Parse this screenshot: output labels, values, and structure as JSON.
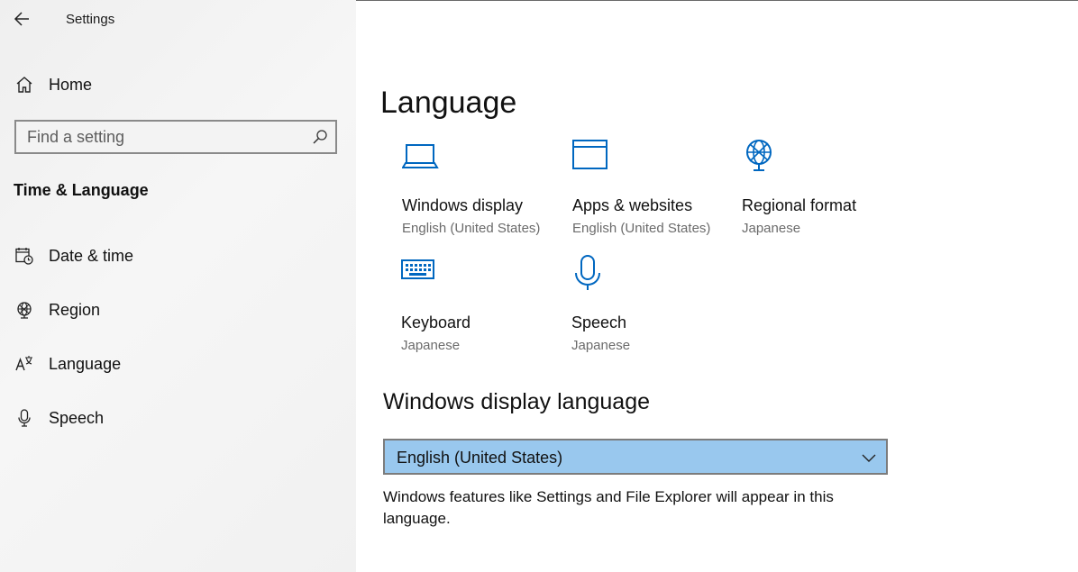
{
  "window": {
    "title": "Settings"
  },
  "sidebar": {
    "home_label": "Home",
    "search": {
      "placeholder": "Find a setting",
      "value": ""
    },
    "section_title": "Time & Language",
    "items": [
      {
        "label": "Date & time",
        "icon": "calendar-clock-icon"
      },
      {
        "label": "Region",
        "icon": "globe-icon"
      },
      {
        "label": "Language",
        "icon": "language-icon"
      },
      {
        "label": "Speech",
        "icon": "microphone-icon"
      }
    ]
  },
  "main": {
    "title": "Language",
    "tiles": [
      {
        "name": "Windows display",
        "value": "English (United States)",
        "icon": "laptop-icon"
      },
      {
        "name": "Apps & websites",
        "value": "English (United States)",
        "icon": "window-icon"
      },
      {
        "name": "Regional format",
        "value": "Japanese",
        "icon": "globe-icon"
      },
      {
        "name": "Keyboard",
        "value": "Japanese",
        "icon": "keyboard-icon"
      },
      {
        "name": "Speech",
        "value": "Japanese",
        "icon": "microphone-icon"
      }
    ],
    "display_language": {
      "heading": "Windows display language",
      "selected": "English (United States)",
      "description": "Windows features like Settings and File Explorer will appear in this language."
    }
  },
  "colors": {
    "accent": "#0067c0",
    "dropdown_bg": "#99c8ee",
    "sidebar_bg": "#f2f2f2"
  }
}
